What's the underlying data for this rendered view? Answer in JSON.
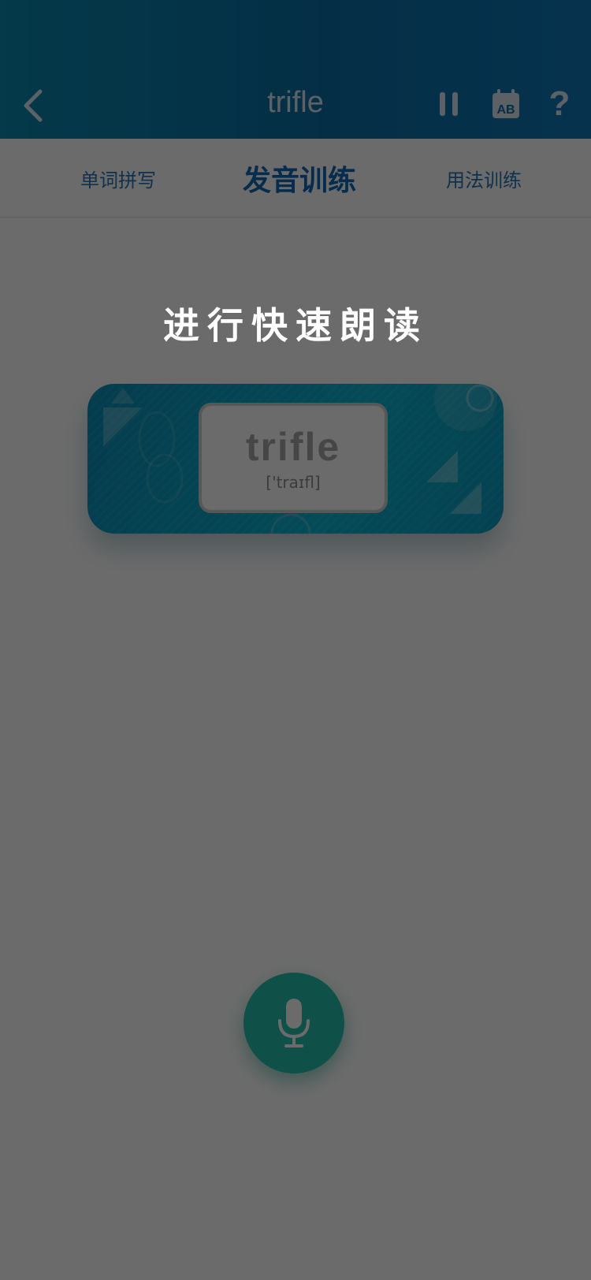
{
  "header": {
    "title": "trifle",
    "back_icon": "chevron-left-icon",
    "pause_icon": "pause-icon",
    "calendar_icon": "calendar-ab-icon",
    "calendar_badge": "AB",
    "help_label": "?"
  },
  "tabs": [
    {
      "label": "单词拼写"
    },
    {
      "label": "发音训练"
    },
    {
      "label": "用法训练"
    }
  ],
  "instruction": "进行快速朗读",
  "word": {
    "text": "trifle",
    "phonetic": "['traɪfl]"
  },
  "mic": {
    "icon": "microphone-icon"
  },
  "colors": {
    "header_bg": "#0b6fa7",
    "active_tab": "#0c69b6",
    "mic_bg": "#25c0ac"
  }
}
